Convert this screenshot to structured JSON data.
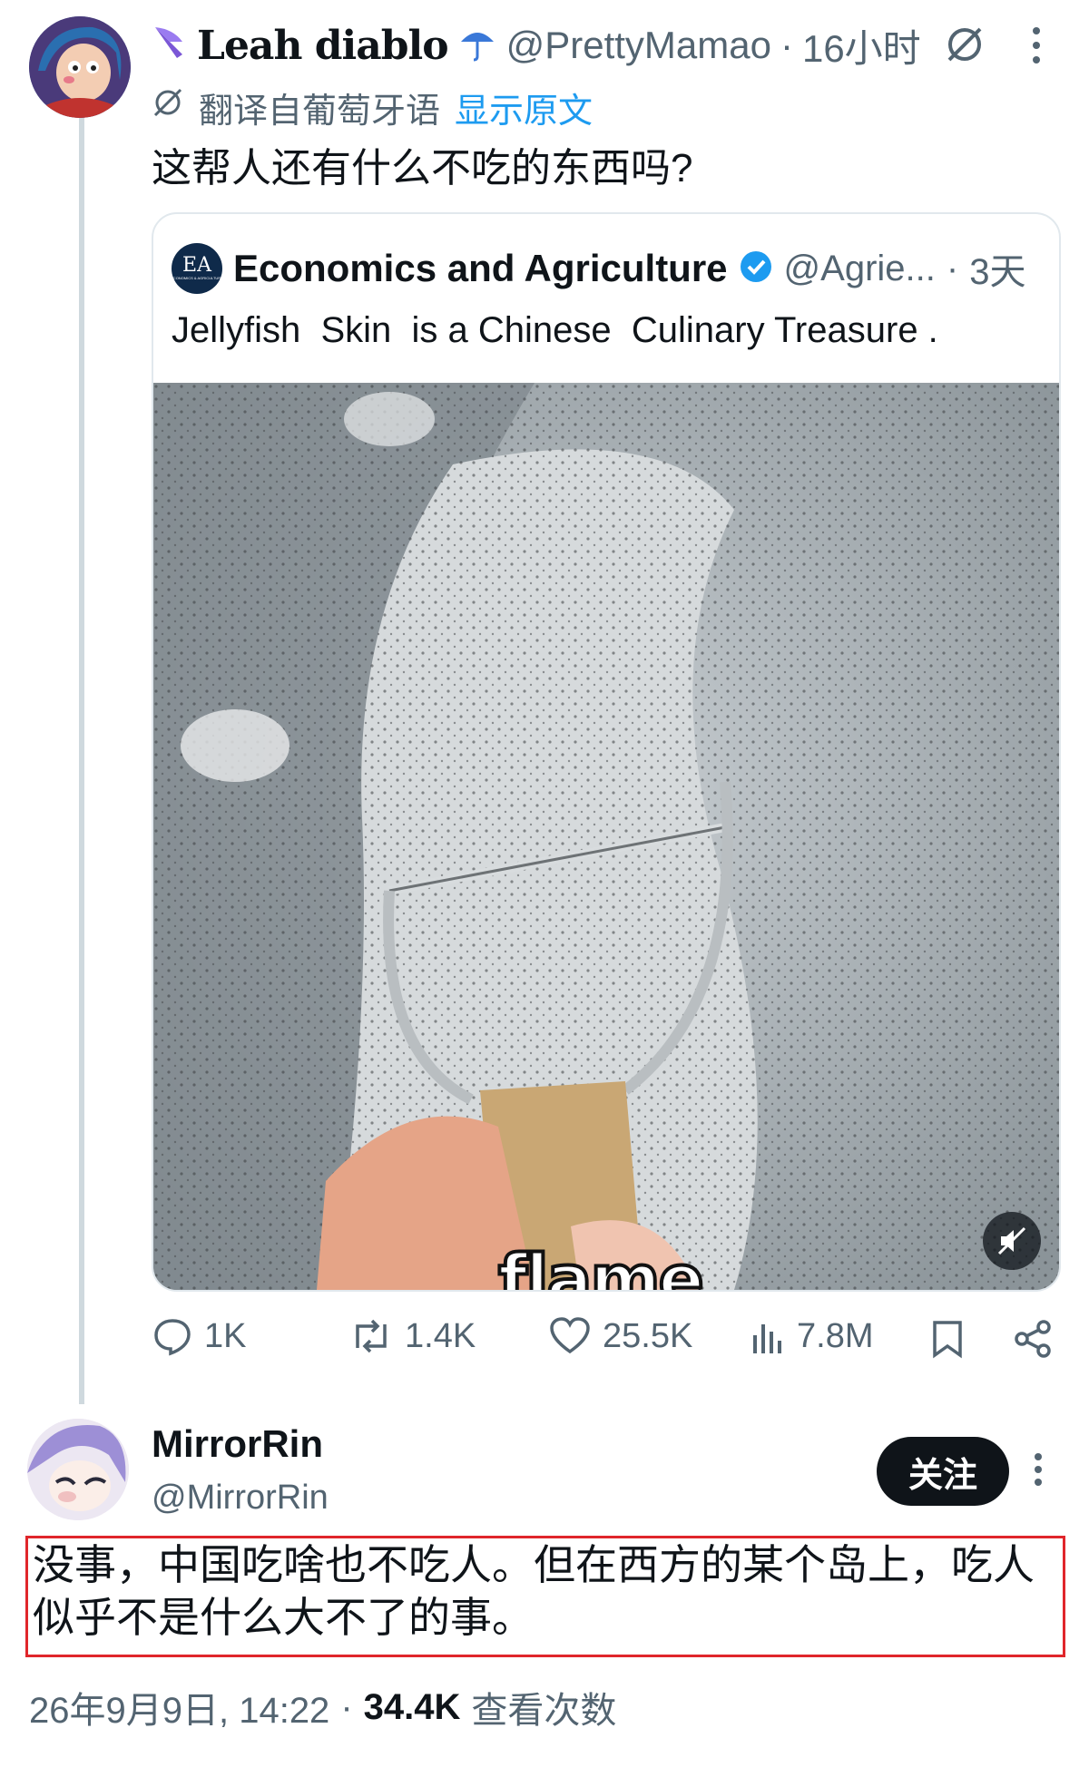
{
  "tweet": {
    "author_name": "Leah diablo",
    "author_handle": "@PrettyMamao",
    "time": "16小时",
    "translate_label": "翻译自葡萄牙语",
    "show_original": "显示原文",
    "text": "这帮人还有什么不吃的东西吗?",
    "icons": {
      "grok": "grok-icon",
      "more": "more-icon",
      "translate": "translate-icon"
    }
  },
  "quote": {
    "logo_text": "EA",
    "logo_sub": "ECONOMICS & AGRICULTURE",
    "author_name": "Economics and Agriculture",
    "verified": true,
    "author_handle": "@Agrie...",
    "time": "3天",
    "text": "Jellyfish  Skin  is a Chinese  Culinary Treasure .",
    "video_caption": "flame",
    "mute_icon": "muted-speaker-icon"
  },
  "actions": {
    "replies": "1K",
    "retweets": "1.4K",
    "likes": "25.5K",
    "views": "7.8M"
  },
  "reply": {
    "author_name": "MirrorRin",
    "author_handle": "@MirrorRin",
    "follow_label": "关注",
    "text": "没事，中国吃啥也不吃人。但在西方的某个岛上，吃人似乎不是什么大不了的事。",
    "timestamp": "26年9月9日, 14:22",
    "views_count": "34.4K",
    "views_label": "查看次数"
  },
  "colors": {
    "accent": "#1d9bf0",
    "highlight_border": "#e0262b",
    "text": "#0f1419",
    "muted": "#536471"
  }
}
